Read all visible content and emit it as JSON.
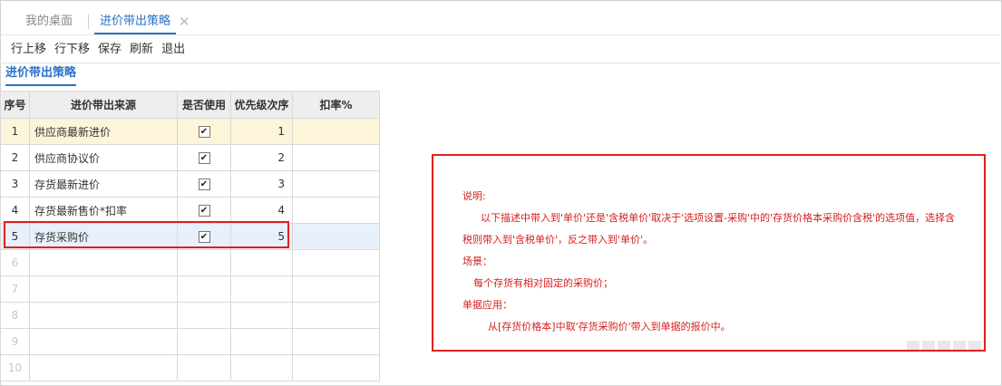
{
  "tabs": {
    "home": "我的桌面",
    "active": "进价带出策略",
    "close": "✕"
  },
  "toolbar": {
    "move_up": "行上移",
    "move_down": "行下移",
    "save": "保存",
    "refresh": "刷新",
    "exit": "退出"
  },
  "subtab": "进价带出策略",
  "grid": {
    "headers": [
      "序号",
      "进价带出来源",
      "是否使用",
      "优先级次序",
      "扣率%"
    ],
    "rows": [
      {
        "idx": "1",
        "source": "供应商最新进价",
        "checked": "✔",
        "priority": "1"
      },
      {
        "idx": "2",
        "source": "供应商协议价",
        "checked": "✔",
        "priority": "2"
      },
      {
        "idx": "3",
        "source": "存货最新进价",
        "checked": "✔",
        "priority": "3"
      },
      {
        "idx": "4",
        "source": "存货最新售价*扣率",
        "checked": "✔",
        "priority": "4"
      },
      {
        "idx": "5",
        "source": "存货采购价",
        "checked": "✔",
        "priority": "5"
      }
    ],
    "empty_rows": [
      "6",
      "7",
      "8",
      "9",
      "10"
    ]
  },
  "note": {
    "title": "说明:",
    "line1": "以下描述中带入到'单价'还是'含税单价'取决于'选项设置-采购'中的'存货价格本采购价含税'的选项值，选择含",
    "line2": "税则带入到'含税单价'，反之带入到'单价'。",
    "scene_title": "场景：",
    "scene": "每个存货有相对固定的采购价；",
    "usage_title": "单据应用：",
    "usage": "从[存货价格本]中取'存货采购价'带入到单据的报价中。"
  }
}
